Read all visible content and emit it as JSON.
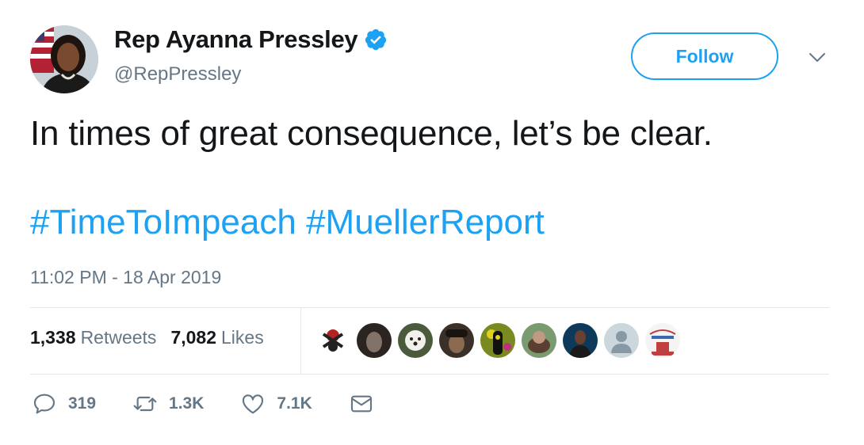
{
  "user": {
    "display_name": "Rep Ayanna Pressley",
    "handle": "@RepPressley",
    "verified_icon": "verified-badge-icon"
  },
  "follow_label": "Follow",
  "tweet": {
    "text": "In times of great consequence, let’s be clear.",
    "hashtags": [
      "#TimeToImpeach",
      "#MuellerReport"
    ],
    "timestamp": "11:02 PM - 18 Apr 2019"
  },
  "stats": {
    "retweets_count": "1,338",
    "retweets_label": "Retweets",
    "likes_count": "7,082",
    "likes_label": "Likes"
  },
  "actions": {
    "replies": "319",
    "retweets": "1.3K",
    "likes": "7.1K"
  },
  "colors": {
    "accent": "#1da1f2",
    "text_primary": "#14171a",
    "text_secondary": "#657786",
    "divider": "#e1e8ed"
  }
}
